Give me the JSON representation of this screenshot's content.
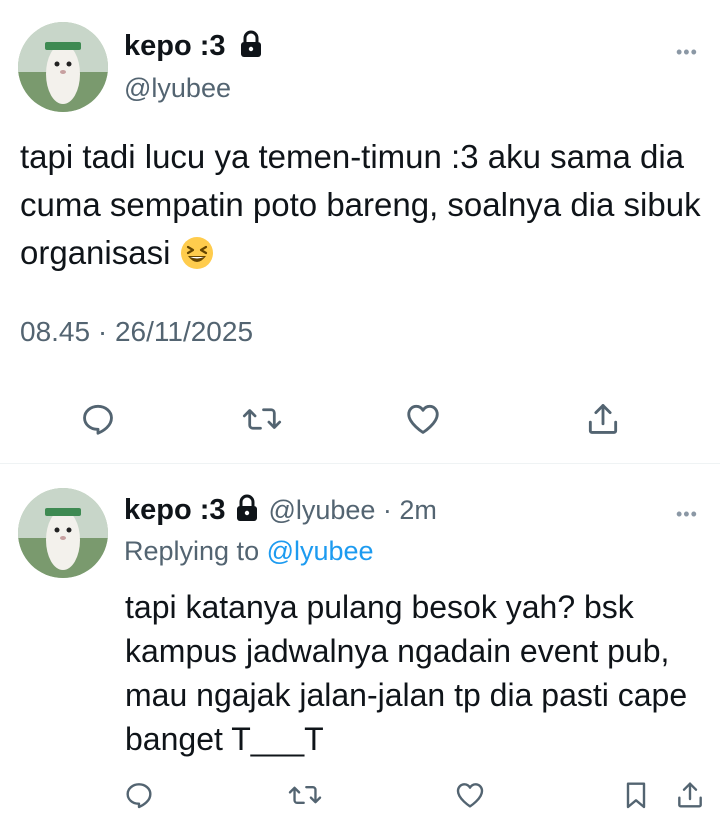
{
  "main_tweet": {
    "display_name": "kepo :3",
    "handle": "@lyubee",
    "more_label": "•••",
    "text": "tapi tadi lucu ya temen-timun :3 aku sama dia cuma sempatin poto bareng, soalnya dia sibuk organisasi",
    "emoji": "grinning-squinting-face",
    "timestamp": "08.45 · 26/11/2025",
    "actions": [
      "reply-icon",
      "retweet-icon",
      "like-icon",
      "share-icon"
    ]
  },
  "reply_tweet": {
    "display_name": "kepo :3",
    "handle_time": "@lyubee · 2m",
    "more_label": "•••",
    "replying_prefix": "Replying to ",
    "replying_handle": "@lyubee",
    "text": "tapi katanya pulang besok yah? bsk kampus jadwalnya ngadain event pub, mau ngajak jalan-jalan tp dia pasti cape banget T___T",
    "actions": [
      "reply-icon",
      "retweet-icon",
      "like-icon",
      "bookmark-icon",
      "share-icon"
    ]
  },
  "colors": {
    "text": "#0f1419",
    "secondary": "#536471",
    "link": "#1d9bf0",
    "divider": "#eff3f4"
  }
}
